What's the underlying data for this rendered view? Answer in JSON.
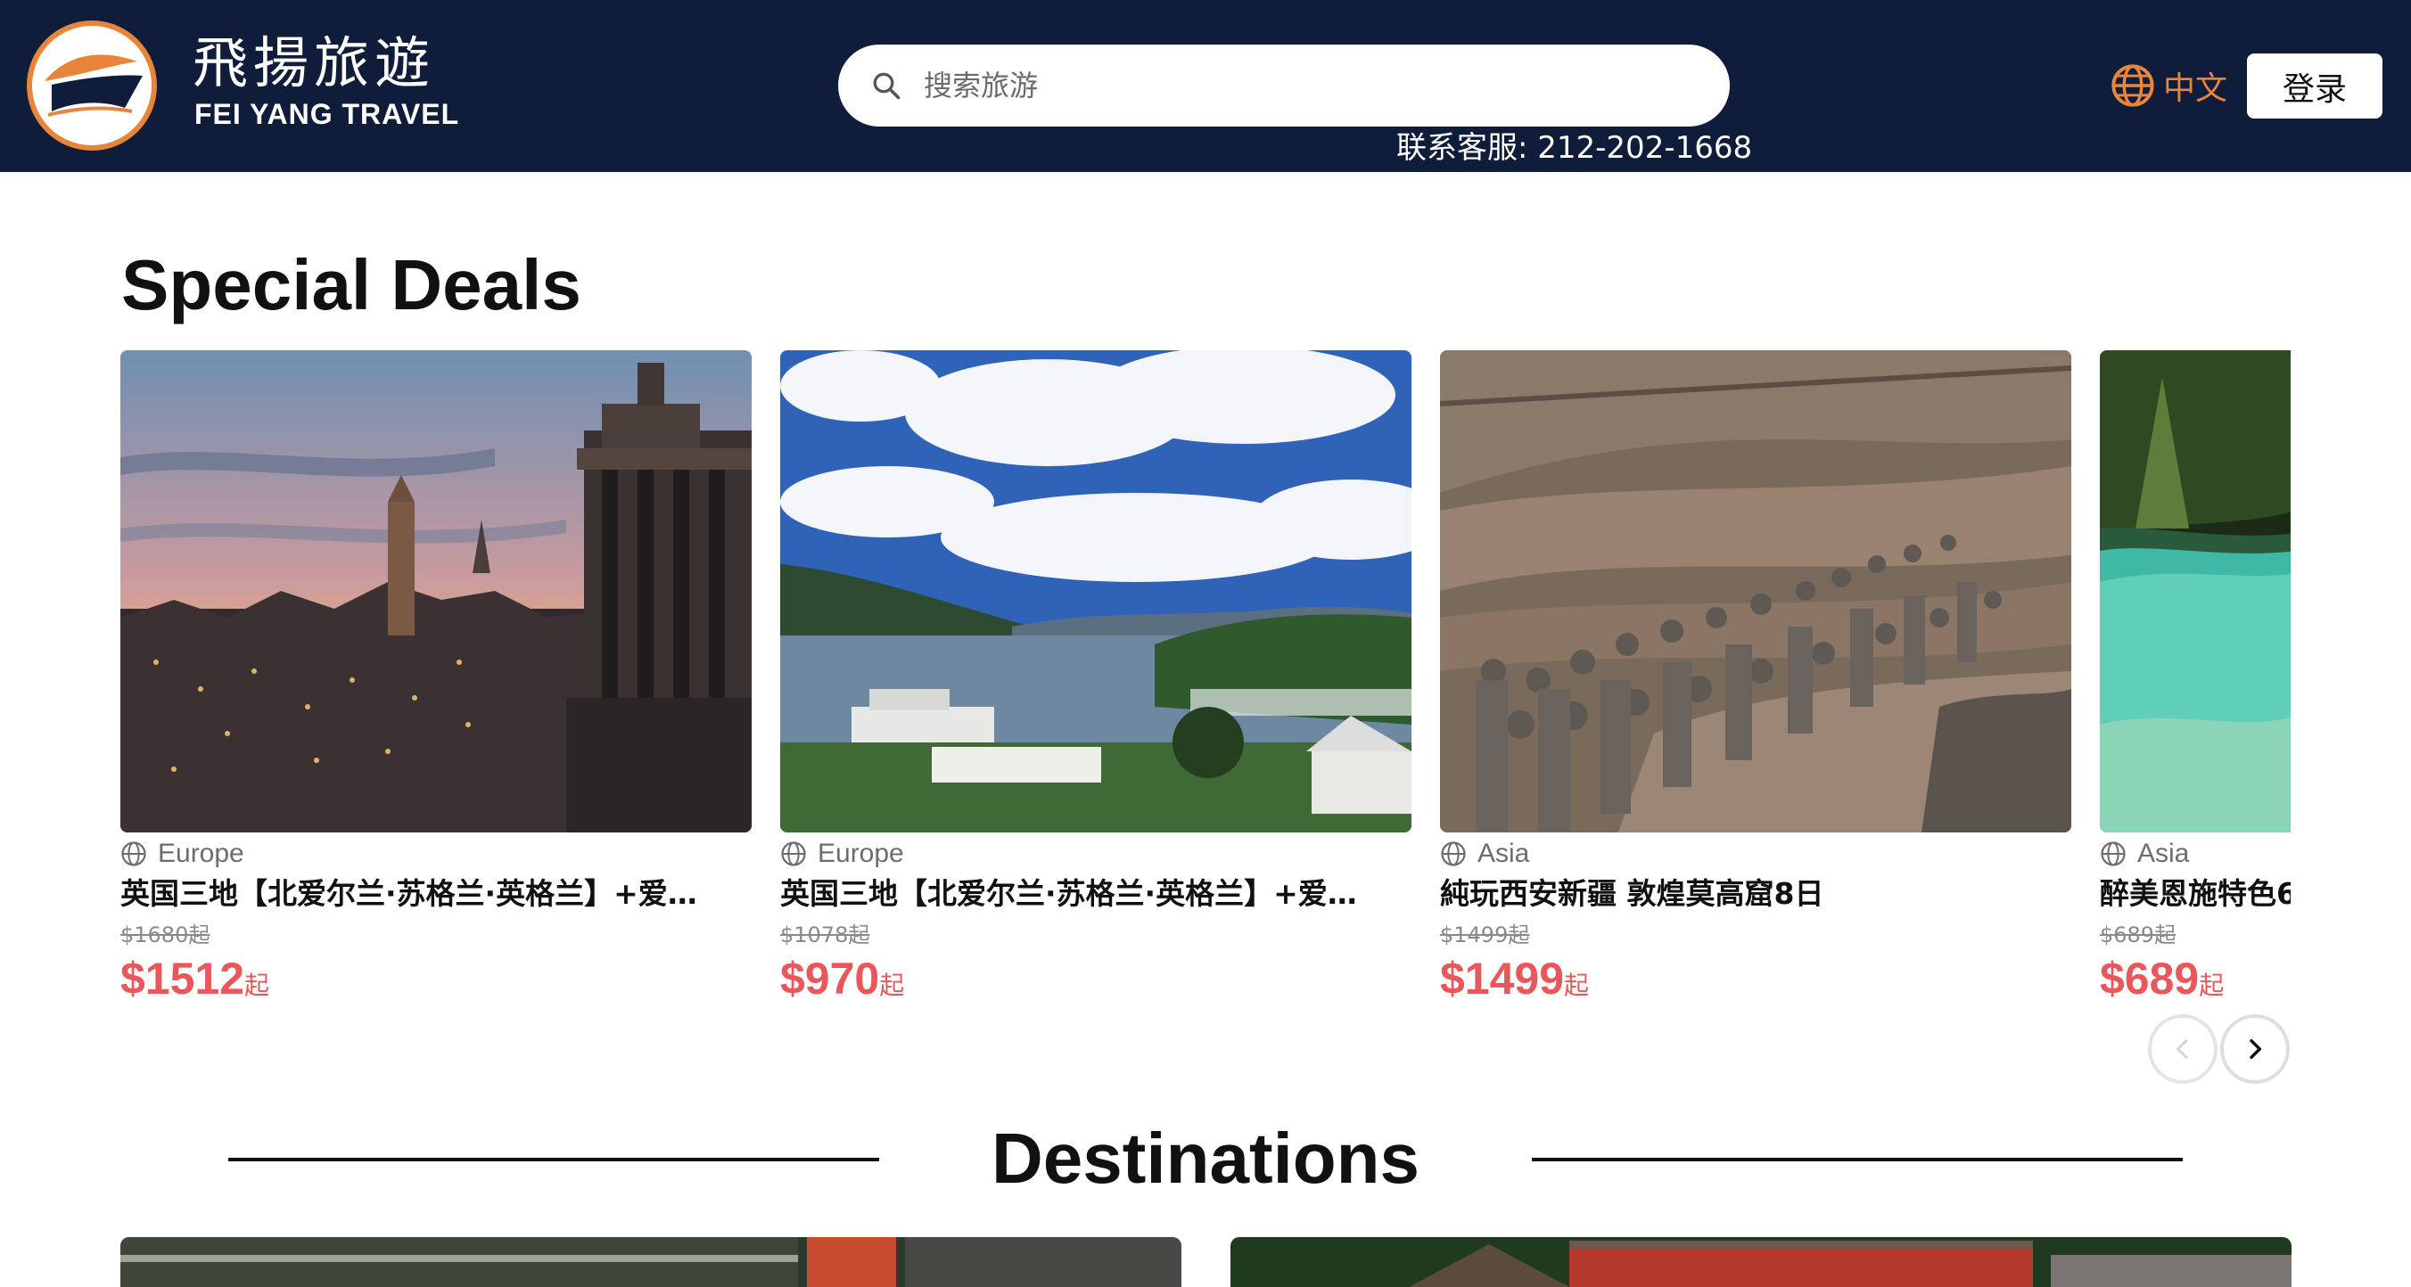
{
  "header": {
    "brand_cn": "飛揚旅遊",
    "brand_en": "FEI YANG TRAVEL",
    "search_placeholder": "搜索旅游",
    "hotline": "联系客服: 212-202-1668",
    "language": "中文",
    "login": "登录",
    "colors": {
      "bg": "#0f1c3a",
      "accent": "#e9843b"
    }
  },
  "special_deals": {
    "title": "Special Deals",
    "price_suffix": "起",
    "items": [
      {
        "region": "Europe",
        "name": "英国三地【北爱尔兰·苏格兰·英格兰】+爱…",
        "original_price": "$1680起",
        "price": "$1512"
      },
      {
        "region": "Europe",
        "name": "英国三地【北爱尔兰·苏格兰·英格兰】+爱…",
        "original_price": "$1078起",
        "price": "$970"
      },
      {
        "region": "Asia",
        "name": "純玩西安新疆 敦煌莫高窟8日",
        "original_price": "$1499起",
        "price": "$1499"
      },
      {
        "region": "Asia",
        "name": "醉美恩施特色6",
        "original_price": "$689起",
        "price": "$689"
      }
    ],
    "price_color": "#e9575a",
    "icons": {
      "region": "globe-icon",
      "prev": "chevron-left-icon",
      "next": "chevron-right-icon"
    }
  },
  "destinations": {
    "title": "Destinations"
  }
}
